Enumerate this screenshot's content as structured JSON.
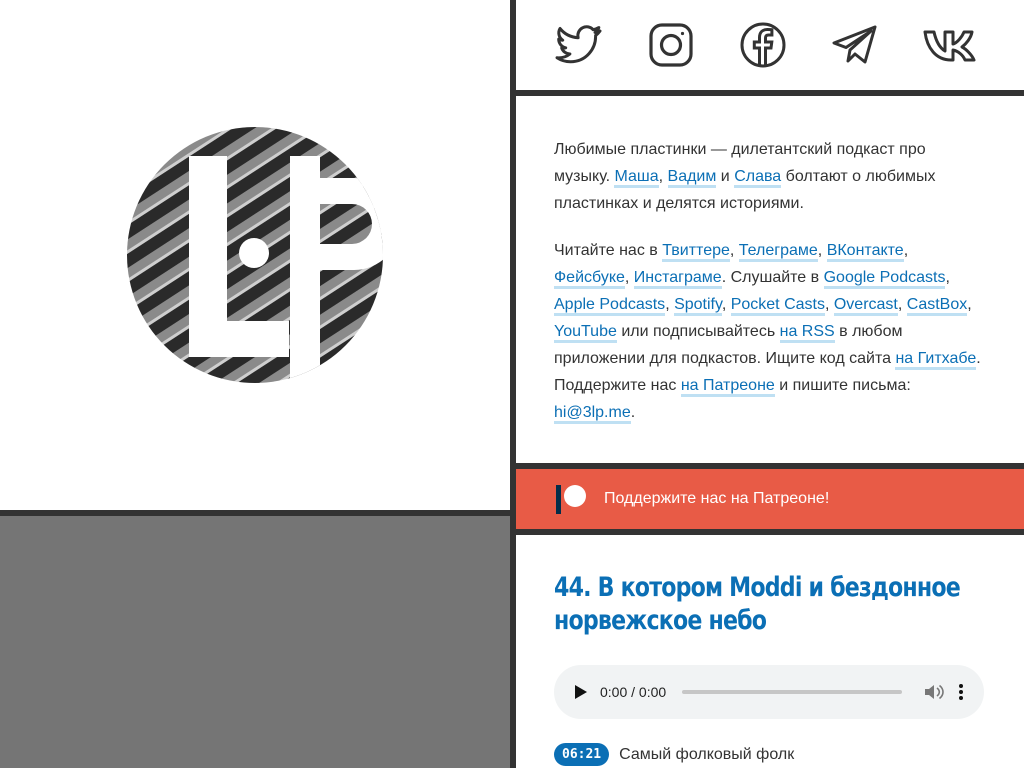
{
  "colors": {
    "accent": "#0b6fb5",
    "link_underline": "#bfe0f3",
    "patreon": "#e85b46",
    "divider": "#333333",
    "panel_gray": "#757575"
  },
  "logo": {
    "text": "LP",
    "icon": "3lp-logo"
  },
  "social": [
    {
      "name": "twitter",
      "icon": "twitter-icon"
    },
    {
      "name": "instagram",
      "icon": "instagram-icon"
    },
    {
      "name": "facebook",
      "icon": "facebook-icon"
    },
    {
      "name": "telegram",
      "icon": "telegram-icon"
    },
    {
      "name": "vk",
      "icon": "vk-icon"
    }
  ],
  "about": {
    "p1": {
      "t1": "Любимые пластинки — дилетантский подкаст про музыку. ",
      "masha": "Маша",
      "c1": ", ",
      "vadim": "Вадим",
      "and": " и ",
      "slava": "Слава",
      "t2": " болтают о любимых пластинках и делятся историями."
    },
    "p2": {
      "t1": "Читайте нас в ",
      "twitter": "Твиттере",
      "c1": ", ",
      "telegram": "Телеграме",
      "c2": ", ",
      "vk": "ВКонтакте",
      "c3": ", ",
      "facebook": "Фейсбуке",
      "c4": ", ",
      "instagram": "Инстаграме",
      "t2": ". Слушайте в ",
      "google": "Google Podcasts",
      "c5": ", ",
      "apple": "Apple Podcasts",
      "c6": ", ",
      "spotify": "Spotify",
      "c7": ", ",
      "pocket": "Pocket Casts",
      "c8": ", ",
      "overcast": "Overcast",
      "c9": ", ",
      "castbox": "CastBox",
      "c10": ", ",
      "youtube": "YouTube",
      "t3": " или подписывайтесь ",
      "rss": "на RSS",
      "t4": " в любом приложении для подкастов. Ищите код сайта ",
      "github": "на Гитхабе",
      "t5": ". Поддержите нас ",
      "patreon": "на Патреоне",
      "t6": " и пишите письма: ",
      "email": "hi@3lp.me",
      "t7": "."
    }
  },
  "patreon_banner": {
    "label": "Поддержите нас на Патреоне!",
    "icon": "patreon-icon"
  },
  "episode": {
    "title": "44. В котором Moddi и бездонное норвежское небо",
    "player": {
      "time": "0:00 / 0:00",
      "progress": 0
    },
    "chapters": [
      {
        "time": "06:21",
        "title": "Самый фолковый фолк"
      }
    ]
  }
}
